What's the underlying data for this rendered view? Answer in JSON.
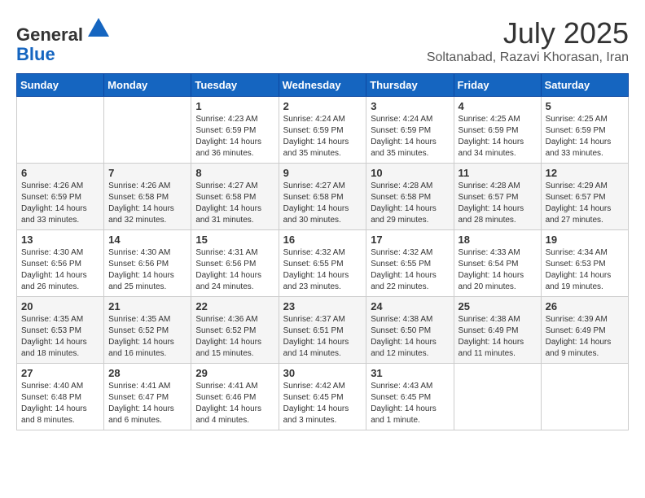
{
  "logo": {
    "general": "General",
    "blue": "Blue"
  },
  "header": {
    "month": "July 2025",
    "location": "Soltanabad, Razavi Khorasan, Iran"
  },
  "weekdays": [
    "Sunday",
    "Monday",
    "Tuesday",
    "Wednesday",
    "Thursday",
    "Friday",
    "Saturday"
  ],
  "weeks": [
    [
      {
        "day": "",
        "info": ""
      },
      {
        "day": "",
        "info": ""
      },
      {
        "day": "1",
        "sunrise": "Sunrise: 4:23 AM",
        "sunset": "Sunset: 6:59 PM",
        "daylight": "Daylight: 14 hours and 36 minutes."
      },
      {
        "day": "2",
        "sunrise": "Sunrise: 4:24 AM",
        "sunset": "Sunset: 6:59 PM",
        "daylight": "Daylight: 14 hours and 35 minutes."
      },
      {
        "day": "3",
        "sunrise": "Sunrise: 4:24 AM",
        "sunset": "Sunset: 6:59 PM",
        "daylight": "Daylight: 14 hours and 35 minutes."
      },
      {
        "day": "4",
        "sunrise": "Sunrise: 4:25 AM",
        "sunset": "Sunset: 6:59 PM",
        "daylight": "Daylight: 14 hours and 34 minutes."
      },
      {
        "day": "5",
        "sunrise": "Sunrise: 4:25 AM",
        "sunset": "Sunset: 6:59 PM",
        "daylight": "Daylight: 14 hours and 33 minutes."
      }
    ],
    [
      {
        "day": "6",
        "sunrise": "Sunrise: 4:26 AM",
        "sunset": "Sunset: 6:59 PM",
        "daylight": "Daylight: 14 hours and 33 minutes."
      },
      {
        "day": "7",
        "sunrise": "Sunrise: 4:26 AM",
        "sunset": "Sunset: 6:58 PM",
        "daylight": "Daylight: 14 hours and 32 minutes."
      },
      {
        "day": "8",
        "sunrise": "Sunrise: 4:27 AM",
        "sunset": "Sunset: 6:58 PM",
        "daylight": "Daylight: 14 hours and 31 minutes."
      },
      {
        "day": "9",
        "sunrise": "Sunrise: 4:27 AM",
        "sunset": "Sunset: 6:58 PM",
        "daylight": "Daylight: 14 hours and 30 minutes."
      },
      {
        "day": "10",
        "sunrise": "Sunrise: 4:28 AM",
        "sunset": "Sunset: 6:58 PM",
        "daylight": "Daylight: 14 hours and 29 minutes."
      },
      {
        "day": "11",
        "sunrise": "Sunrise: 4:28 AM",
        "sunset": "Sunset: 6:57 PM",
        "daylight": "Daylight: 14 hours and 28 minutes."
      },
      {
        "day": "12",
        "sunrise": "Sunrise: 4:29 AM",
        "sunset": "Sunset: 6:57 PM",
        "daylight": "Daylight: 14 hours and 27 minutes."
      }
    ],
    [
      {
        "day": "13",
        "sunrise": "Sunrise: 4:30 AM",
        "sunset": "Sunset: 6:56 PM",
        "daylight": "Daylight: 14 hours and 26 minutes."
      },
      {
        "day": "14",
        "sunrise": "Sunrise: 4:30 AM",
        "sunset": "Sunset: 6:56 PM",
        "daylight": "Daylight: 14 hours and 25 minutes."
      },
      {
        "day": "15",
        "sunrise": "Sunrise: 4:31 AM",
        "sunset": "Sunset: 6:56 PM",
        "daylight": "Daylight: 14 hours and 24 minutes."
      },
      {
        "day": "16",
        "sunrise": "Sunrise: 4:32 AM",
        "sunset": "Sunset: 6:55 PM",
        "daylight": "Daylight: 14 hours and 23 minutes."
      },
      {
        "day": "17",
        "sunrise": "Sunrise: 4:32 AM",
        "sunset": "Sunset: 6:55 PM",
        "daylight": "Daylight: 14 hours and 22 minutes."
      },
      {
        "day": "18",
        "sunrise": "Sunrise: 4:33 AM",
        "sunset": "Sunset: 6:54 PM",
        "daylight": "Daylight: 14 hours and 20 minutes."
      },
      {
        "day": "19",
        "sunrise": "Sunrise: 4:34 AM",
        "sunset": "Sunset: 6:53 PM",
        "daylight": "Daylight: 14 hours and 19 minutes."
      }
    ],
    [
      {
        "day": "20",
        "sunrise": "Sunrise: 4:35 AM",
        "sunset": "Sunset: 6:53 PM",
        "daylight": "Daylight: 14 hours and 18 minutes."
      },
      {
        "day": "21",
        "sunrise": "Sunrise: 4:35 AM",
        "sunset": "Sunset: 6:52 PM",
        "daylight": "Daylight: 14 hours and 16 minutes."
      },
      {
        "day": "22",
        "sunrise": "Sunrise: 4:36 AM",
        "sunset": "Sunset: 6:52 PM",
        "daylight": "Daylight: 14 hours and 15 minutes."
      },
      {
        "day": "23",
        "sunrise": "Sunrise: 4:37 AM",
        "sunset": "Sunset: 6:51 PM",
        "daylight": "Daylight: 14 hours and 14 minutes."
      },
      {
        "day": "24",
        "sunrise": "Sunrise: 4:38 AM",
        "sunset": "Sunset: 6:50 PM",
        "daylight": "Daylight: 14 hours and 12 minutes."
      },
      {
        "day": "25",
        "sunrise": "Sunrise: 4:38 AM",
        "sunset": "Sunset: 6:49 PM",
        "daylight": "Daylight: 14 hours and 11 minutes."
      },
      {
        "day": "26",
        "sunrise": "Sunrise: 4:39 AM",
        "sunset": "Sunset: 6:49 PM",
        "daylight": "Daylight: 14 hours and 9 minutes."
      }
    ],
    [
      {
        "day": "27",
        "sunrise": "Sunrise: 4:40 AM",
        "sunset": "Sunset: 6:48 PM",
        "daylight": "Daylight: 14 hours and 8 minutes."
      },
      {
        "day": "28",
        "sunrise": "Sunrise: 4:41 AM",
        "sunset": "Sunset: 6:47 PM",
        "daylight": "Daylight: 14 hours and 6 minutes."
      },
      {
        "day": "29",
        "sunrise": "Sunrise: 4:41 AM",
        "sunset": "Sunset: 6:46 PM",
        "daylight": "Daylight: 14 hours and 4 minutes."
      },
      {
        "day": "30",
        "sunrise": "Sunrise: 4:42 AM",
        "sunset": "Sunset: 6:45 PM",
        "daylight": "Daylight: 14 hours and 3 minutes."
      },
      {
        "day": "31",
        "sunrise": "Sunrise: 4:43 AM",
        "sunset": "Sunset: 6:45 PM",
        "daylight": "Daylight: 14 hours and 1 minute."
      },
      {
        "day": "",
        "info": ""
      },
      {
        "day": "",
        "info": ""
      }
    ]
  ]
}
